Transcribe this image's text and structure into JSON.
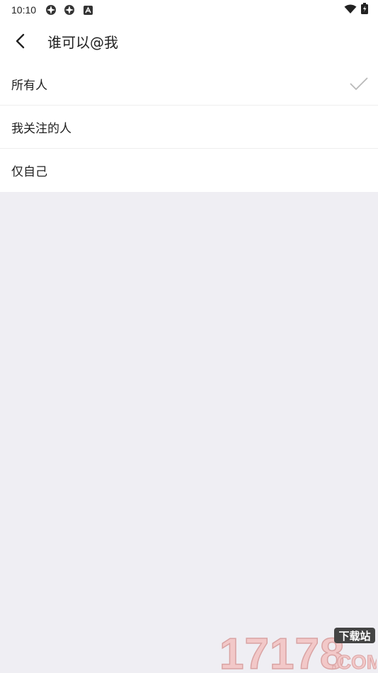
{
  "status_bar": {
    "time": "10:10",
    "icons": [
      "app-icon",
      "app-icon",
      "a-badge-icon"
    ],
    "right_icons": [
      "wifi-icon",
      "battery-icon"
    ]
  },
  "header": {
    "title": "谁可以@我",
    "back_icon": "chevron-left-icon"
  },
  "options": [
    {
      "label": "所有人",
      "selected": true
    },
    {
      "label": "我关注的人",
      "selected": false
    },
    {
      "label": "仅自己",
      "selected": false
    }
  ],
  "watermark": {
    "number": "17178",
    "tagline": "下载站",
    "domain": ".COM"
  },
  "colors": {
    "background": "#efeef3",
    "surface": "#ffffff",
    "check": "#b9b9b9",
    "watermark_number": "#f2c8c8",
    "watermark_tagline_bg": "#444444"
  }
}
